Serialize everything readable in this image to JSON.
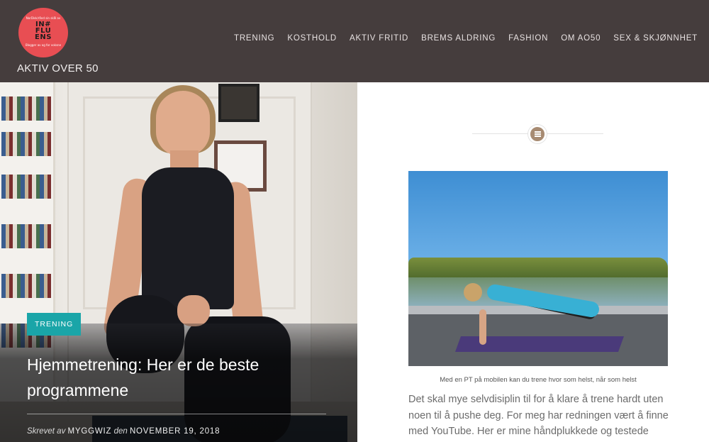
{
  "header": {
    "logo": {
      "tag_top": "NorDisk/rånd sin skål av",
      "mark": "IN# FLU ENS",
      "tag_bot": "Blogger av og for voksne"
    },
    "site_title": "AKTIV OVER 50",
    "nav": [
      "TRENING",
      "KOSTHOLD",
      "AKTIV FRITID",
      "BREMS ALDRING",
      "FASHION",
      "OM AO50",
      "SEX & SKJØNNHET"
    ]
  },
  "featured": {
    "category": "TRENING",
    "title": "Hjemmetrening: Her er de beste programmene",
    "meta": {
      "written_by_label": "Skrevet av",
      "author": "MYGGWIZ",
      "date_label": "den",
      "date": "NOVEMBER 19, 2018"
    }
  },
  "article": {
    "format_icon": "standard-post-icon",
    "image_caption": "Med en PT på mobilen kan du trene hvor som helst, når som helst",
    "body": "Det skal mye selvdisiplin til for å klare å trene hardt uten noen til å pushe deg.  For meg har redningen vært å finne med YouTube. Her er mine håndplukkede og testede"
  },
  "colors": {
    "header_bg": "#453d3d",
    "logo_bg": "#e84e53",
    "badge_bg": "#1aa5a8",
    "format_icon_bg": "#a78b72"
  }
}
